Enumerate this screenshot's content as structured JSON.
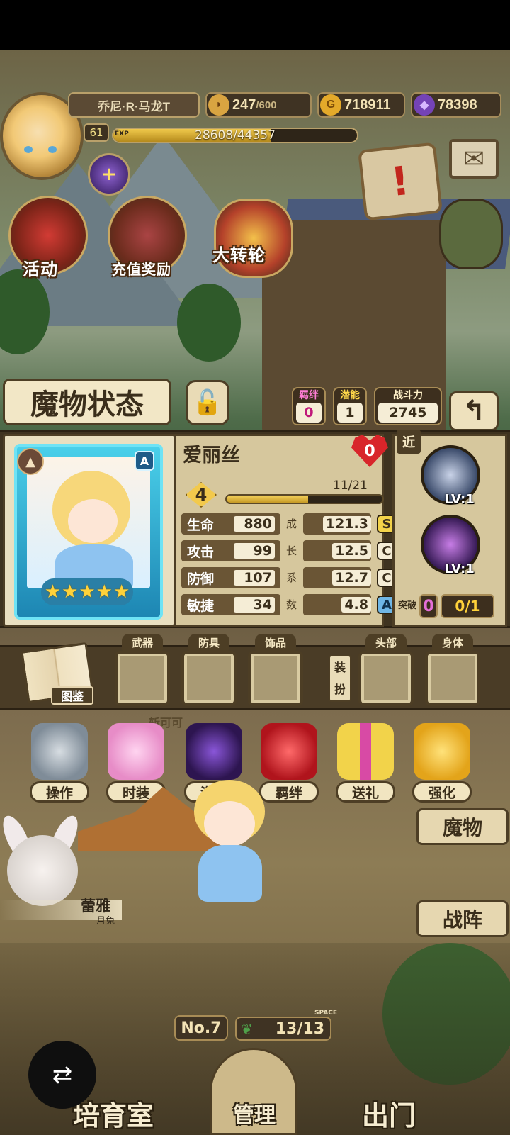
{
  "player": {
    "name": "乔尼·R·马龙T",
    "level": "61",
    "exp_tag": "EXP",
    "exp_text": "28608/44357",
    "exp_fraction": 0.645
  },
  "resources": {
    "stamina": "247",
    "stamina_max": "/600",
    "gold": "718911",
    "gems": "78398"
  },
  "events": {
    "activity": "活动",
    "recharge": "充值奖励",
    "wheel": "大转轮"
  },
  "panel": {
    "title": "魔物状态",
    "bond_label": "羁绊",
    "bond_value": "0",
    "potential_label": "潜能",
    "potential_value": "1",
    "power_label": "战斗力",
    "power_value": "2745"
  },
  "monster": {
    "name": "爱丽丝",
    "rank": "A",
    "stars": 5,
    "heart_value": "0",
    "level": "4",
    "level_progress_text": "11/21",
    "level_progress_fraction": 0.524,
    "range_tag": "近",
    "stats": [
      {
        "label": "生命",
        "value": "880",
        "growth": "121.3",
        "grade": "S"
      },
      {
        "label": "攻击",
        "value": "99",
        "growth": "12.5",
        "grade": "C"
      },
      {
        "label": "防御",
        "value": "107",
        "growth": "12.7",
        "grade": "C"
      },
      {
        "label": "敏捷",
        "value": "34",
        "growth": "4.8",
        "grade": "A"
      }
    ],
    "growth_chars": [
      "成",
      "长",
      "系",
      "数"
    ],
    "skills": [
      {
        "level": "LV:1",
        "icon": "rabbit-skill-icon"
      },
      {
        "level": "LV:1",
        "icon": "dark-magic-skill-icon"
      }
    ],
    "breakthrough_label": "突破",
    "breakthrough_value": "0",
    "breakthrough_progress": "0/1"
  },
  "equipment": {
    "codex_label": "图鉴",
    "slots": [
      "武器",
      "防具",
      "饰品",
      "头部",
      "身体"
    ],
    "dress_label": "装扮"
  },
  "actions": [
    "操作",
    "时装",
    "潜能",
    "羁绊",
    "送礼",
    "强化"
  ],
  "side": {
    "monsters": "魔物",
    "formation": "战阵"
  },
  "companion": {
    "name": "蕾雅",
    "type": "月兔"
  },
  "footer": {
    "number": "No.7",
    "space_tag": "SPACE",
    "space": "13/13",
    "breed": "培育室",
    "manage": "管理",
    "exit": "出门",
    "faded_text": "斩可可"
  }
}
